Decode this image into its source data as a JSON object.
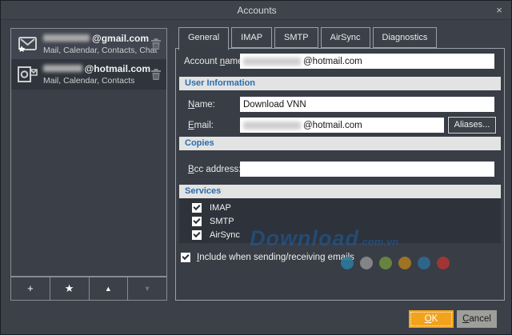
{
  "window": {
    "title": "Accounts",
    "close_glyph": "×"
  },
  "account_list": {
    "accounts": [
      {
        "email_suffix": "@gmail.com",
        "services": "Mail, Calendar, Contacts, Chat"
      },
      {
        "email_suffix": "@hotmail.com",
        "services": "Mail, Calendar, Contacts"
      }
    ],
    "toolbar": {
      "add": "+",
      "favorite": "★",
      "move_up": "▲",
      "move_down": "▼"
    }
  },
  "tabs": [
    {
      "label": "General"
    },
    {
      "label": "IMAP"
    },
    {
      "label": "SMTP"
    },
    {
      "label": "AirSync"
    },
    {
      "label": "Diagnostics"
    }
  ],
  "general_tab": {
    "account_name": {
      "label": {
        "pre": "Account ",
        "accel": "n",
        "post": "ame:"
      },
      "value_suffix": "@hotmail.com"
    },
    "sections": {
      "user_information": "User Information",
      "copies": "Copies",
      "services": "Services"
    },
    "name": {
      "label": {
        "pre": "",
        "accel": "N",
        "post": "ame:"
      },
      "value": "Download VNN"
    },
    "email": {
      "label": {
        "pre": "",
        "accel": "E",
        "post": "mail:"
      },
      "value_suffix": "@hotmail.com",
      "aliases_button": "Aliases..."
    },
    "bcc": {
      "label": {
        "pre": "",
        "accel": "B",
        "post": "cc address:"
      },
      "value": ""
    },
    "service_checks": [
      {
        "label": "IMAP",
        "checked": true
      },
      {
        "label": "SMTP",
        "checked": true
      },
      {
        "label": "AirSync",
        "checked": true
      }
    ],
    "include": {
      "label": {
        "pre": "",
        "accel": "I",
        "post": "nclude when sending/receiving emails"
      },
      "checked": true
    }
  },
  "footer": {
    "ok": {
      "pre": "",
      "accel": "O",
      "post": "K"
    },
    "cancel": {
      "pre": "",
      "accel": "C",
      "post": "ancel"
    }
  },
  "watermark": {
    "main": "Download",
    "suffix": ".com.vn",
    "dot_colors": [
      "#2c7ca0",
      "#8f9092",
      "#6e9040",
      "#b07c1e",
      "#2d6d96",
      "#b13431"
    ]
  },
  "colors": {
    "accent_orange": "#f2a31d",
    "section_header_blue": "#2b6cac",
    "watermark_blue": "#1e5fa5"
  }
}
